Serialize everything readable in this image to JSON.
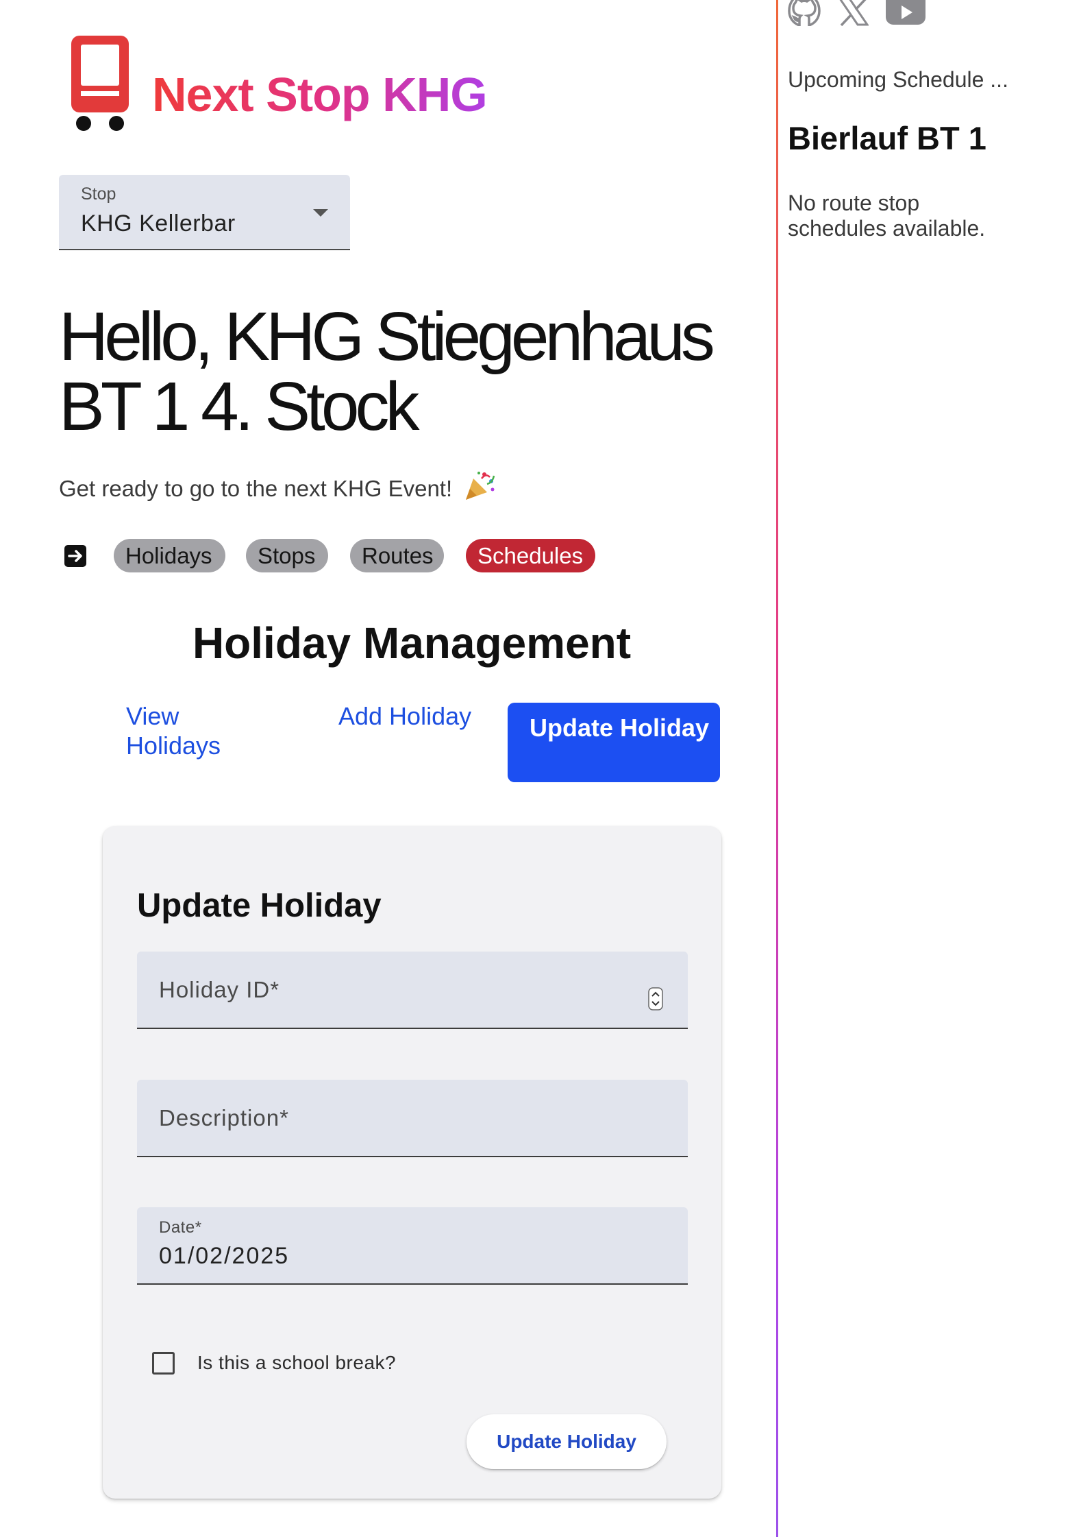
{
  "app": {
    "title": "Next Stop KHG"
  },
  "stop_select": {
    "label": "Stop",
    "value": "KHG Kellerbar"
  },
  "greeting": {
    "title": "Hello, KHG Stiegenhaus BT 1 4. Stock",
    "subtitle": "Get ready to go to the next KHG Event!"
  },
  "nav": {
    "items": [
      {
        "label": "Holidays",
        "active": false
      },
      {
        "label": "Stops",
        "active": false
      },
      {
        "label": "Routes",
        "active": false
      },
      {
        "label": "Schedules",
        "active": true
      }
    ]
  },
  "section": {
    "title": "Holiday Management"
  },
  "tabs": [
    {
      "label": "View Holidays",
      "active": false
    },
    {
      "label": "Add Holiday",
      "active": false
    },
    {
      "label": "Update Holiday",
      "active": true
    }
  ],
  "form": {
    "title": "Update Holiday",
    "holiday_id": {
      "placeholder": "Holiday ID*",
      "value": ""
    },
    "description": {
      "placeholder": "Description*",
      "value": ""
    },
    "date": {
      "label": "Date*",
      "value": "01/02/2025"
    },
    "school_break": {
      "label": "Is this a school break?",
      "checked": false
    },
    "submit_label": "Update Holiday"
  },
  "sidebar": {
    "heading": "Upcoming Schedule ...",
    "route_name": "Bierlauf BT 1",
    "empty_message": "No route stop schedules available.",
    "social_icons": [
      "github-icon",
      "x-icon",
      "youtube-icon"
    ]
  },
  "colors": {
    "brand_red": "#e23a3a",
    "brand_gradient_end": "#b03ee2",
    "active_chip": "#c12734",
    "chip_bg": "#a3a3a7",
    "primary_blue": "#1c4ff2",
    "link_blue": "#1d4fe0",
    "field_bg": "#e1e4ed",
    "card_bg": "#f2f2f4"
  }
}
